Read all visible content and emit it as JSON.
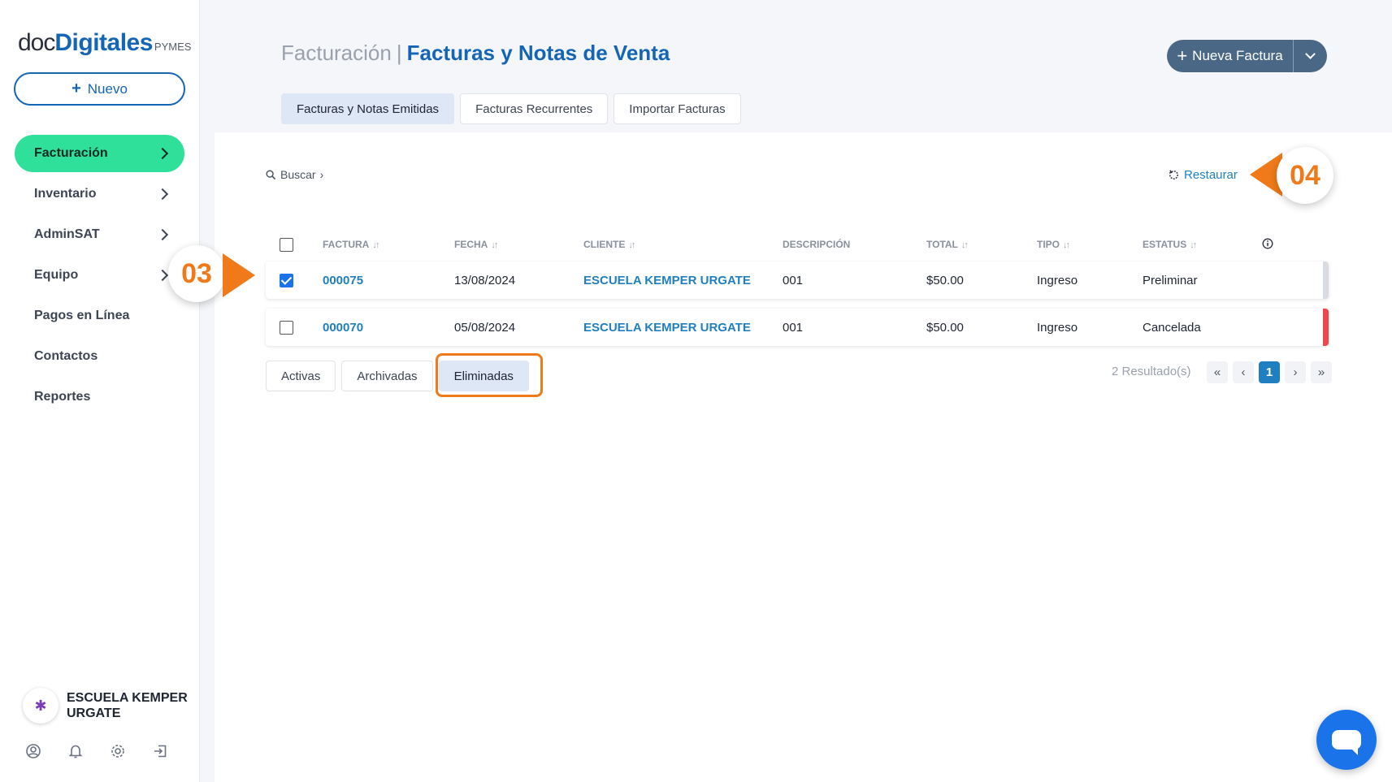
{
  "brand": {
    "doc": "doc",
    "digitales": "Digitales",
    "pymes": "PYMES"
  },
  "new_button": {
    "plus": "+",
    "label": "Nuevo"
  },
  "nav": [
    {
      "label": "Facturación",
      "active": true,
      "chevron": true
    },
    {
      "label": "Inventario",
      "chevron": true
    },
    {
      "label": "AdminSAT",
      "chevron": true
    },
    {
      "label": "Equipo",
      "chevron": true
    },
    {
      "label": "Pagos en Línea",
      "chevron": false
    },
    {
      "label": "Contactos",
      "chevron": false
    },
    {
      "label": "Reportes",
      "chevron": false
    }
  ],
  "account": {
    "name_line1": "ESCUELA KEMPER",
    "name_line2": "URGATE"
  },
  "header": {
    "section": "Facturación",
    "separator": "|",
    "page": "Facturas y Notas de Venta"
  },
  "nueva_factura": {
    "plus": "+",
    "label": "Nueva Factura"
  },
  "tabs": [
    "Facturas y Notas Emitidas",
    "Facturas Recurrentes",
    "Importar Facturas"
  ],
  "search": {
    "label": "Buscar",
    "chevron": "›"
  },
  "restaurar": {
    "label": "Restaurar"
  },
  "callouts": {
    "step3": "03",
    "step4": "04"
  },
  "table": {
    "columns": [
      "FACTURA",
      "FECHA",
      "CLIENTE",
      "DESCRIPCIÓN",
      "TOTAL",
      "TIPO",
      "ESTATUS"
    ],
    "rows": [
      {
        "checked": true,
        "factura": "000075",
        "fecha": "13/08/2024",
        "cliente": "ESCUELA KEMPER URGATE",
        "descripcion": "001",
        "total": "$50.00",
        "tipo": "Ingreso",
        "estatus": "Preliminar",
        "status_color": "#d8dbe0"
      },
      {
        "checked": false,
        "factura": "000070",
        "fecha": "05/08/2024",
        "cliente": "ESCUELA KEMPER URGATE",
        "descripcion": "001",
        "total": "$50.00",
        "tipo": "Ingreso",
        "estatus": "Cancelada",
        "status_color": "#f0474f"
      }
    ]
  },
  "filters": [
    "Activas",
    "Archivadas",
    "Eliminadas"
  ],
  "pagination": {
    "results": "2 Resultado(s)",
    "current_page": "1"
  },
  "colors": {
    "accent": "#1565b7",
    "active_nav": "#2fe09a",
    "callout": "#f07a1a"
  }
}
